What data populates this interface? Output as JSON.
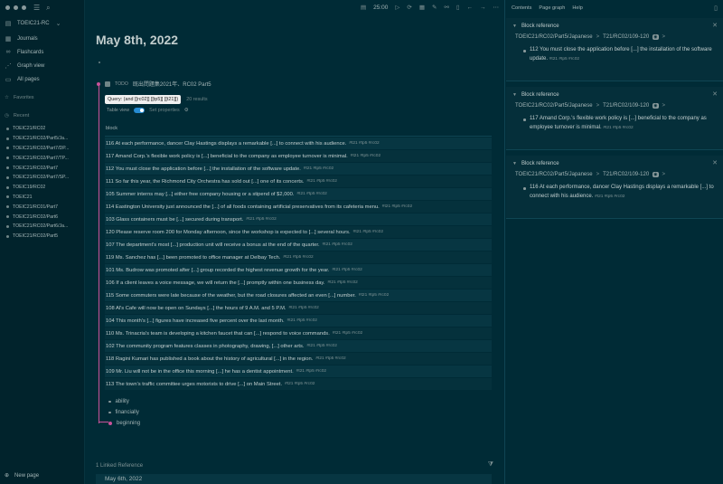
{
  "sidebar": {
    "graph_name": "TOEIC21-RC",
    "nav": [
      {
        "label": "Journals",
        "icon": "calendar-icon"
      },
      {
        "label": "Flashcards",
        "icon": "infinity-icon"
      },
      {
        "label": "Graph view",
        "icon": "graph-icon"
      },
      {
        "label": "All pages",
        "icon": "pages-icon"
      }
    ],
    "favorites_label": "Favorites",
    "recent_label": "Recent",
    "recent": [
      "TOEIC21/RC02",
      "TOEIC21/RC02/Part5/Ja...",
      "TOEIC21/RC02/Part7/DP...",
      "TOEIC21/RC02/Part7/TP...",
      "TOEIC21/RC02/Part7",
      "TOEIC21/RC02/Part7/SP...",
      "TOEIC19/RC02",
      "TOEIC21",
      "TOEIC21/RC01/Part7",
      "TOEIC21/RC02/Part6",
      "TOEIC21/RC02/Part6/Ja...",
      "TOEIC21/RC02/Part5"
    ],
    "new_page_label": "New page"
  },
  "toolbar": {
    "timer": "25:00"
  },
  "page": {
    "title": "May 8th, 2022",
    "todo_marker": "TODO",
    "todo_text": "既出問題集2021年、RC02 Part5",
    "query": "Query: (and [[rc02]] [[tp5]] [[t21]])",
    "query_count": "20 results",
    "table_view_label": "Table view",
    "set_properties_label": "Set properties",
    "column_header": "block",
    "results": [
      {
        "text": "116 At each performance, dancer Clay Hastings displays a remarkable [...] to connect with his audience.",
        "tags": "#t21 #tp5 #rc02"
      },
      {
        "text": "117 Amand Corp.'s flexible work policy is [...] beneficial to the company as employee turnover is minimal.",
        "tags": "#t21 #tp5 #rc02"
      },
      {
        "text": "112 You must close the application before [...] the installation of the software update.",
        "tags": "#t21 #tp5 #rc02"
      },
      {
        "text": "111 So far this year, the Richmond City Orchestra has sold out [...] one of its concerts.",
        "tags": "#t21 #tp5 #rc02"
      },
      {
        "text": "105 Summer interns may [...] either free company housing or a stipend of $2,000.",
        "tags": "#t21 #tp5 #rc02"
      },
      {
        "text": "114 Eastington University just announced the [...] of all foods containing artificial preservatives from its cafeteria menu.",
        "tags": "#t21 #tp5 #rc02"
      },
      {
        "text": "103 Glass containers must be [...] secured during transport.",
        "tags": "#t21 #tp5 #rc02"
      },
      {
        "text": "120 Please reserve room 200 for Monday afternoon, since the workshop is expected to [...] several hours.",
        "tags": "#t21 #tp5 #rc02"
      },
      {
        "text": "107 The department's most [...] production unit will receive a bonus at the end of the quarter.",
        "tags": "#t21 #tp5 #rc02"
      },
      {
        "text": "119 Ms. Sanchez has [...] been promoted to office manager at Delbay Tech.",
        "tags": "#t21 #tp5 #rc02"
      },
      {
        "text": "101 Ms. Budrow was promoted after [...] group recorded the highest revenue growth for the year.",
        "tags": "#t21 #tp5 #rc02"
      },
      {
        "text": "106 If a client leaves a voice message, we will return the [...] promptly within one business day.",
        "tags": "#t21 #tp5 #rc02"
      },
      {
        "text": "115 Some commuters were late because of the weather, but the road closures affected an even [...] number.",
        "tags": "#t21 #tp5 #rc02"
      },
      {
        "text": "108 Al's Cafe will now be open on Sundays [...] the hours of 9 A.M. and 5 P.M.",
        "tags": "#t21 #tp5 #rc02"
      },
      {
        "text": "104 This month's [...] figures have increased five percent over the last month.",
        "tags": "#t21 #tp5 #rc02"
      },
      {
        "text": "110 Ms. Trinacria's team is developing a kitchen faucet that can [...] respond to voice commands.",
        "tags": "#t21 #tp5 #rc02"
      },
      {
        "text": "102 The community program features classes in photography, drawing, [...] other arts.",
        "tags": "#t21 #tp5 #rc02"
      },
      {
        "text": "118 Ragini Kumari has published a book about the history of agricultural [...] in the region.",
        "tags": "#t21 #tp5 #rc02"
      },
      {
        "text": "109 Mr. Liu will not be in the office this morning [...] he has a dentist appointment.",
        "tags": "#t21 #tp5 #rc02"
      },
      {
        "text": "113 The town's traffic committee urges motorists to drive [...] on Main Street.",
        "tags": "#t21 #tp5 #rc02"
      }
    ],
    "children": [
      "ability",
      "financially",
      "beginning"
    ],
    "linked_ref_label": "1 Linked Reference",
    "linked_page": "May 6th, 2022"
  },
  "right_panel": {
    "tabs": [
      "Contents",
      "Page graph",
      "Help"
    ],
    "cards": [
      {
        "title": "Block reference",
        "crumb_page": "TOEIC21/RC02/Part5/Japanese",
        "crumb_sub": "T21/RC02/109-120",
        "text": "112 You must close the application before [...] the installation of the software update.",
        "tags": "#t21 #tp5 #rc02"
      },
      {
        "title": "Block reference",
        "crumb_page": "TOEIC21/RC02/Part5/Japanese",
        "crumb_sub": "T21/RC02/109-120",
        "text": "117 Amand Corp.'s flexible work policy is [...] beneficial to the company as employee turnover is minimal.",
        "tags": "#t21 #tp5 #rc02"
      },
      {
        "title": "Block reference",
        "crumb_page": "TOEIC21/RC02/Part5/Japanese",
        "crumb_sub": "T21/RC02/109-120",
        "text": "116 At each performance, dancer Clay Hastings displays a remarkable [...] to connect with his audience.",
        "tags": "#t21 #tp5 #rc02"
      }
    ]
  }
}
